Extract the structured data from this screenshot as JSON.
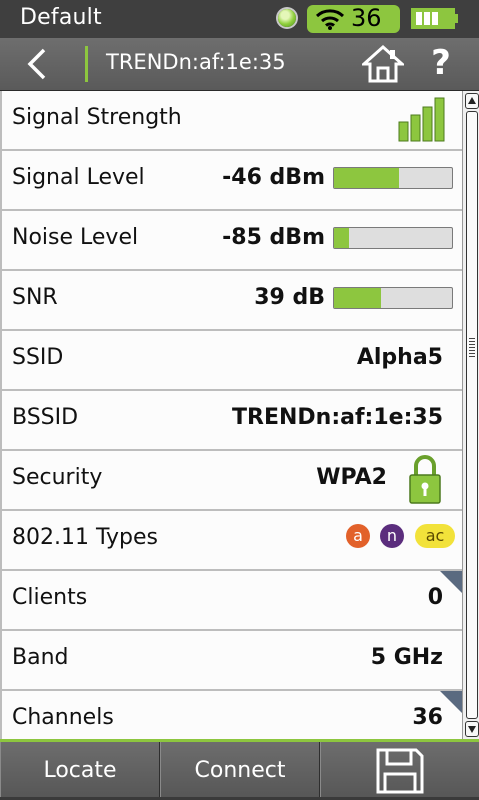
{
  "status_bar": {
    "profile_name": "Default",
    "wifi_count": "36"
  },
  "nav_bar": {
    "title": "TRENDn:af:1e:35"
  },
  "rows": {
    "signal_strength": {
      "label": "Signal Strength",
      "bars": 4
    },
    "signal_level": {
      "label": "Signal Level",
      "value": "-46 dBm",
      "bar_fraction": 0.55
    },
    "noise_level": {
      "label": "Noise Level",
      "value": "-85 dBm",
      "bar_fraction": 0.13
    },
    "snr": {
      "label": "SNR",
      "value": "39 dB",
      "bar_fraction": 0.4
    },
    "ssid": {
      "label": "SSID",
      "value": "Alpha5"
    },
    "bssid": {
      "label": "BSSID",
      "value": "TRENDn:af:1e:35"
    },
    "security": {
      "label": "Security",
      "value": "WPA2"
    },
    "types": {
      "label": "802.11 Types",
      "badges": [
        "a",
        "n",
        "ac"
      ]
    },
    "clients": {
      "label": "Clients",
      "value": "0"
    },
    "band": {
      "label": "Band",
      "value": "5 GHz"
    },
    "channels": {
      "label": "Channels",
      "value": "36"
    }
  },
  "buttons": {
    "locate": "Locate",
    "connect": "Connect"
  },
  "colors": {
    "accent": "#8dc63f",
    "header": "#5a5a5a",
    "phy_a": "#e2612a",
    "phy_n": "#5b2d7d",
    "phy_ac": "#f2e23a"
  },
  "icons": [
    "wifi-icon",
    "battery-icon",
    "back-icon",
    "home-icon",
    "help-icon",
    "signal-bars-icon",
    "lock-icon",
    "save-icon"
  ]
}
